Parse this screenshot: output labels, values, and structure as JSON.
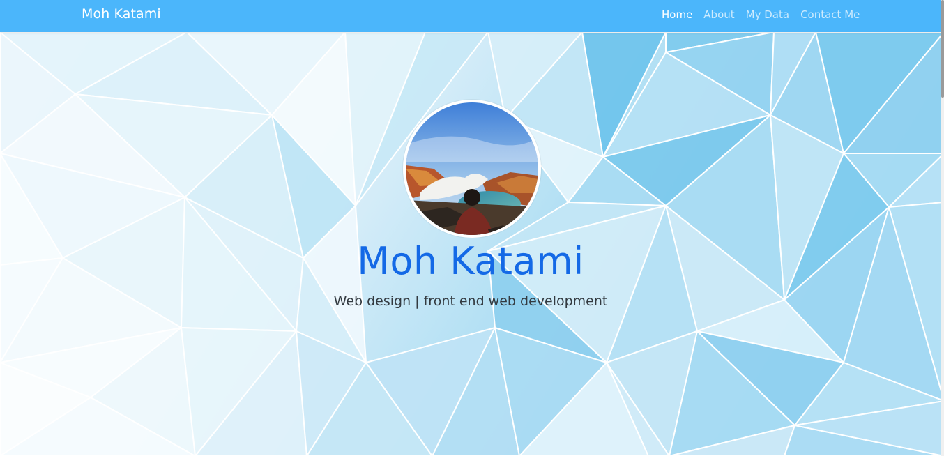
{
  "navbar": {
    "brand": "Moh Katami",
    "links": [
      {
        "label": "Home",
        "active": true
      },
      {
        "label": "About",
        "active": false
      },
      {
        "label": "My Data",
        "active": false
      },
      {
        "label": "Contact Me",
        "active": false
      }
    ],
    "background_color": "#4bb6fb"
  },
  "hero": {
    "name": "Moh Katami",
    "tagline": "Web design | front end web development",
    "name_color": "#1469e6",
    "avatar_icon": "profile-photo"
  }
}
